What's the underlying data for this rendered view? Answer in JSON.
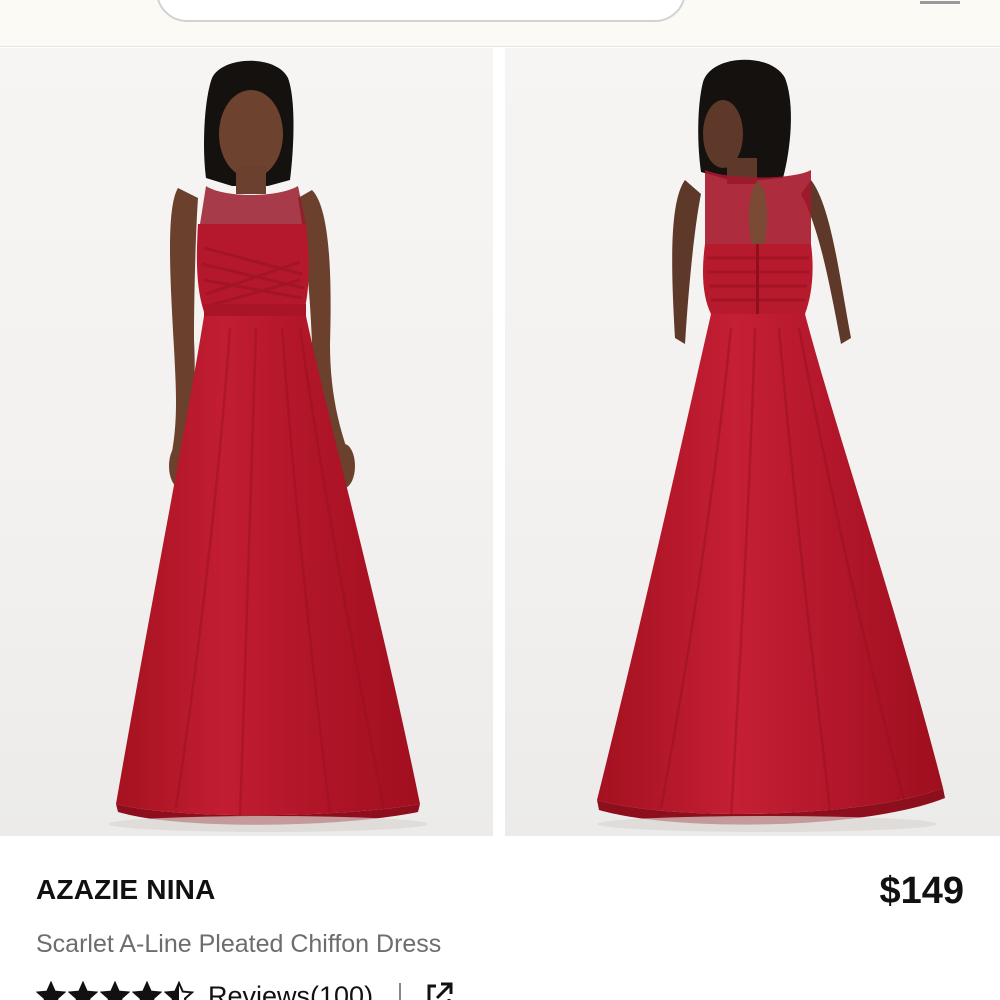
{
  "header": {
    "search": {
      "value": "",
      "icon": "search-field"
    },
    "menu_icon": "menu-icon"
  },
  "gallery": {
    "images": [
      {
        "view": "front",
        "description_icon": "product-photo-front"
      },
      {
        "view": "back",
        "description_icon": "product-photo-back"
      }
    ]
  },
  "product": {
    "brand": "AZAZIE NINA",
    "price": "$149",
    "title": "Scarlet A-Line Pleated Chiffon Dress",
    "rating": 4.5,
    "rating_max": 5,
    "reviews_label": "Reviews(100)",
    "share_icon": "share-external-icon"
  },
  "colors": {
    "dress": "#b8172c",
    "text_primary": "#111111",
    "text_secondary": "#6d6d6d",
    "star": "#111111"
  }
}
